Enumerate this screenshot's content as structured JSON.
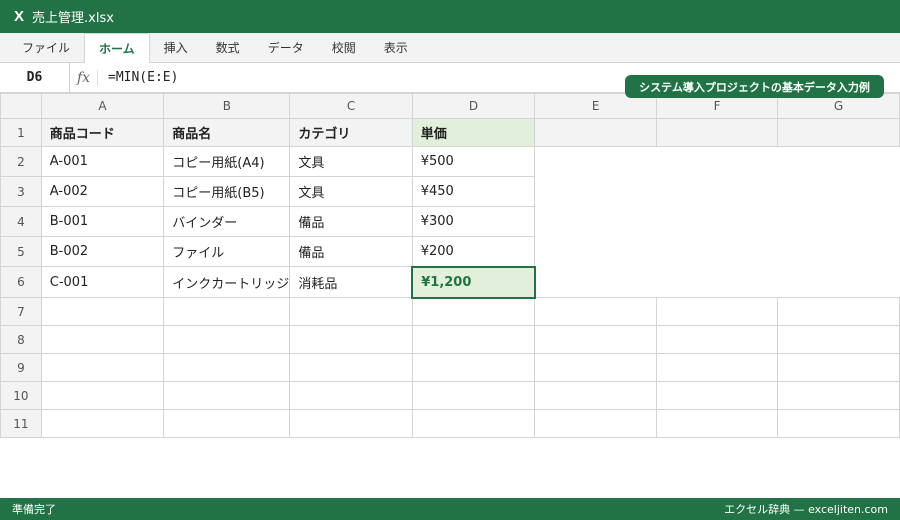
{
  "window": {
    "logo": "X",
    "title": "売上管理.xlsx"
  },
  "ribbon": {
    "tabs": [
      "ファイル",
      "ホーム",
      "挿入",
      "数式",
      "データ",
      "校閲",
      "表示"
    ],
    "active_tab": "ホーム"
  },
  "formula_bar": {
    "cell_ref": "D6",
    "fx_label": "fx",
    "formula": "=MIN(E:E)"
  },
  "banner": "システム導入プロジェクトの基本データ入力例",
  "sheet": {
    "columns": [
      "A",
      "B",
      "C",
      "D",
      "E",
      "F",
      "G"
    ],
    "rows": [
      "1",
      "2",
      "3",
      "4",
      "5",
      "6",
      "7",
      "8",
      "9",
      "10",
      "11"
    ],
    "header": [
      "商品コード",
      "商品名",
      "カテゴリ",
      "単価"
    ],
    "data": [
      [
        "A-001",
        "コピー用紙(A4)",
        "文具",
        "¥500"
      ],
      [
        "A-002",
        "コピー用紙(B5)",
        "文具",
        "¥450"
      ],
      [
        "B-001",
        "バインダー",
        "備品",
        "¥300"
      ],
      [
        "B-002",
        "ファイル",
        "備品",
        "¥200"
      ],
      [
        "C-001",
        "インクカートリッジ",
        "消耗品",
        "¥1,200"
      ]
    ],
    "selected_cell": "D6"
  },
  "status": {
    "left": "準備完了",
    "right": "エクセル辞典 — exceljiten.com"
  },
  "colors": {
    "accent": "#217346",
    "selected_fill": "#e2efda",
    "gridline": "#d4d4d4"
  }
}
